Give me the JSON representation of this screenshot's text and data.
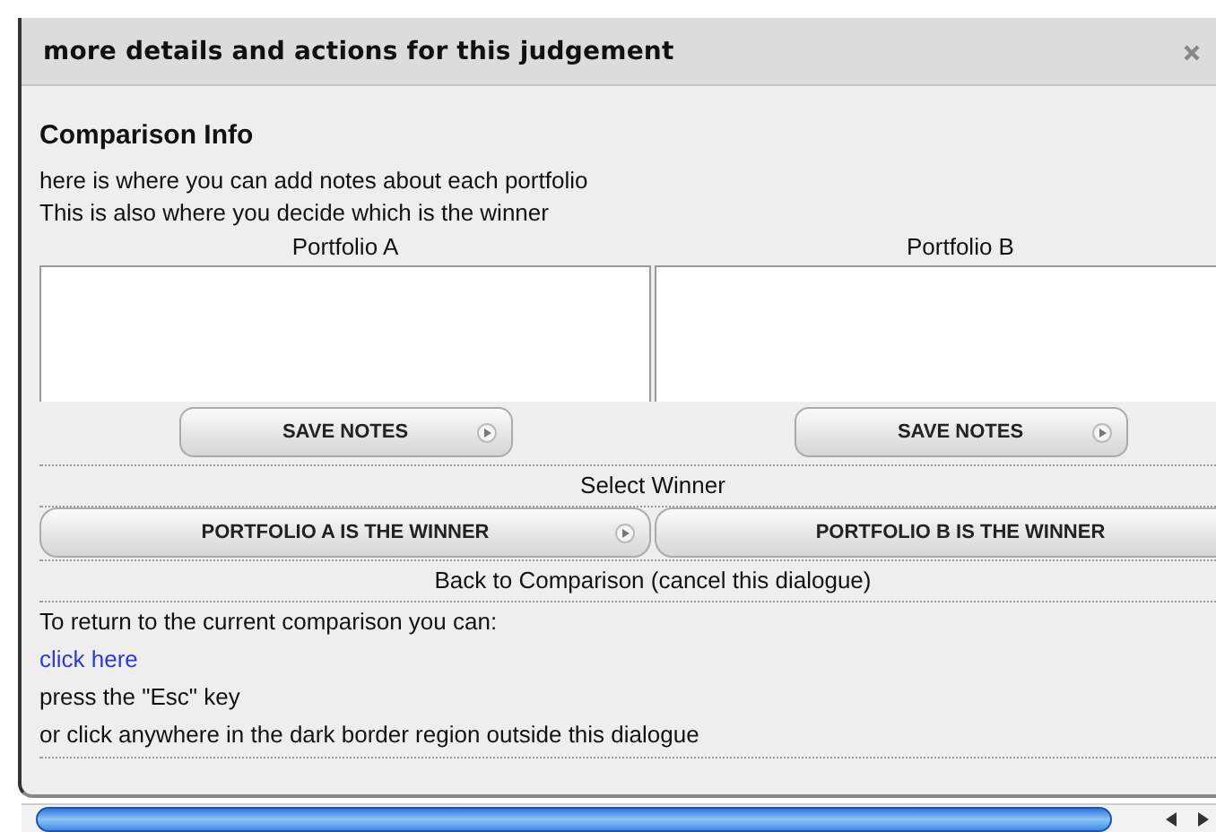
{
  "dialog": {
    "title": "more details and actions for this judgement"
  },
  "section_title": "Comparison Info",
  "intro": [
    "here is where you can add notes about each portfolio",
    "This is also where you decide which is the winner"
  ],
  "portfolios": [
    {
      "label": "Portfolio A",
      "save_button": "SAVE NOTES"
    },
    {
      "label": "Portfolio B",
      "save_button": "SAVE NOTES"
    }
  ],
  "select_winner": {
    "heading": "Select Winner",
    "buttons": [
      "PORTFOLIO A IS THE WINNER",
      "PORTFOLIO B IS THE WINNER"
    ]
  },
  "back": {
    "heading": "Back to Comparison (cancel this dialogue)",
    "intro": "To return to the current comparison you can:",
    "link": "click here",
    "options": [
      "press the \"Esc\" key",
      "or click anywhere in the dark border region outside this dialogue"
    ]
  }
}
